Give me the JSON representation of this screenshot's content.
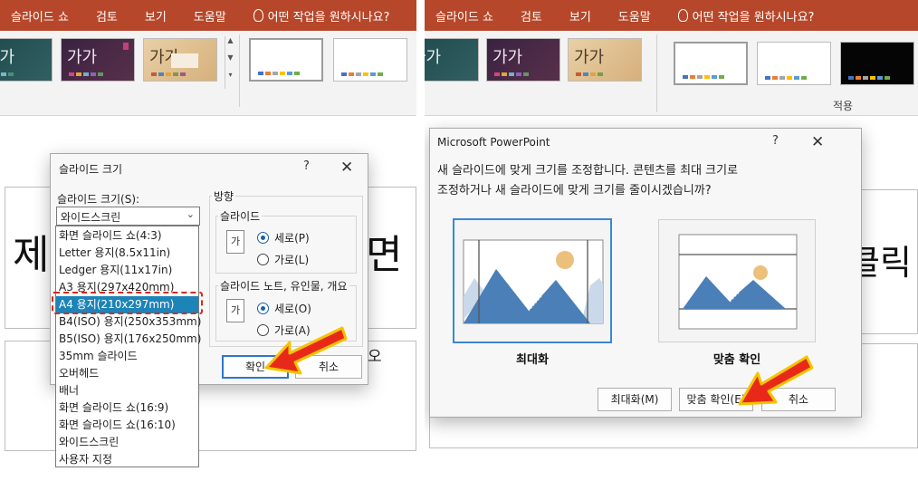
{
  "left": {
    "ribbon": {
      "tabs": [
        "슬라이드 쇼",
        "검토",
        "보기",
        "도움말"
      ],
      "tell_me": "어떤 작업을 원하시나요?",
      "themes": [
        {
          "sample": "가가",
          "style": "teal"
        },
        {
          "sample": "가가",
          "style": "purple"
        },
        {
          "sample": "가가",
          "style": "sand"
        },
        {
          "sample": "",
          "style": "white"
        },
        {
          "sample": "",
          "style": "white"
        }
      ]
    },
    "slide": {
      "char_left": "제",
      "char_right": "면",
      "char_bottom": "오"
    },
    "dialog": {
      "title": "슬라이드 크기",
      "help": "?",
      "close": "✕",
      "size_label": "슬라이드 크기(S):",
      "size_value": "와이드스크린",
      "options": [
        "화면 슬라이드 쇼(4:3)",
        "Letter 용지(8.5x11in)",
        "Ledger 용지(11x17in)",
        "A3 용지(297x420mm)",
        "A4 용지(210x297mm)",
        "B4(ISO) 용지(250x353mm)",
        "B5(ISO) 용지(176x250mm)",
        "35mm 슬라이드",
        "오버헤드",
        "배너",
        "화면 슬라이드 쇼(16:9)",
        "화면 슬라이드 쇼(16:10)",
        "와이드스크린",
        "사용자 지정"
      ],
      "selected_index": 4,
      "orientation_label": "방향",
      "slides_group": "슬라이드",
      "notes_group": "슬라이드 노트, 유인물, 개요",
      "portrait": "세로(P)",
      "landscape": "가로(L)",
      "notes_portrait": "세로(O)",
      "notes_landscape": "가로(A)",
      "icon_glyph": "가",
      "ok": "확인",
      "cancel": "취소"
    }
  },
  "right": {
    "ribbon": {
      "tabs": [
        "슬라이드 쇼",
        "검토",
        "보기",
        "도움말"
      ],
      "tell_me": "어떤 작업을 원하시나요?",
      "apply_label": "적용",
      "themes": [
        {
          "sample": "가가",
          "style": "teal"
        },
        {
          "sample": "가가",
          "style": "purple"
        },
        {
          "sample": "가가",
          "style": "sand"
        },
        {
          "sample": "",
          "style": "white"
        },
        {
          "sample": "",
          "style": "white"
        },
        {
          "sample": "",
          "style": "black"
        }
      ]
    },
    "slide": {
      "char_right": "클릭"
    },
    "dialog": {
      "title": "Microsoft PowerPoint",
      "help": "?",
      "close": "✕",
      "message_line1": "새 슬라이드에 맞게 크기를 조정합니다. 콘텐츠를 최대 크기로",
      "message_line2": "조정하거나 새 슬라이드에 맞게 크기를 줄이시겠습니까?",
      "maximize_label": "최대화",
      "fit_label": "맞춤 확인",
      "btn_maximize": "최대화(M)",
      "btn_fit": "맞춤 확인(E)",
      "btn_cancel": "취소"
    }
  },
  "colors": {
    "ribbon": "#b7472a",
    "selection": "#1d84b7",
    "highlight": "#d42b1c",
    "arrow": "#e8291a",
    "arrow_outline": "#f5c400",
    "mountain": "#4a7fb8",
    "mountain_light": "#c9d9ea",
    "sun": "#ecc07a"
  }
}
